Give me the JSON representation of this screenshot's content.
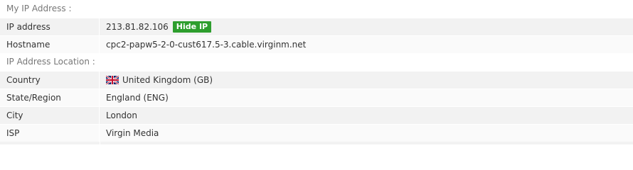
{
  "section1": {
    "heading": "My IP Address :",
    "rows": [
      {
        "label": "IP address",
        "value": "213.81.82.106",
        "button": "Hide IP"
      },
      {
        "label": "Hostname",
        "value": "cpc2-papw5-2-0-cust617.5-3.cable.virginm.net"
      }
    ]
  },
  "section2": {
    "heading": "IP Address Location :",
    "rows": [
      {
        "label": "Country",
        "value": "United Kingdom (GB)",
        "icon": "uk-flag-icon"
      },
      {
        "label": "State/Region",
        "value": "England (ENG)"
      },
      {
        "label": "City",
        "value": "London"
      },
      {
        "label": "ISP",
        "value": "Virgin Media"
      }
    ]
  },
  "colors": {
    "button_bg": "#2e9e2e",
    "row_bg": "#f2f2f2",
    "heading_text": "#777777"
  }
}
